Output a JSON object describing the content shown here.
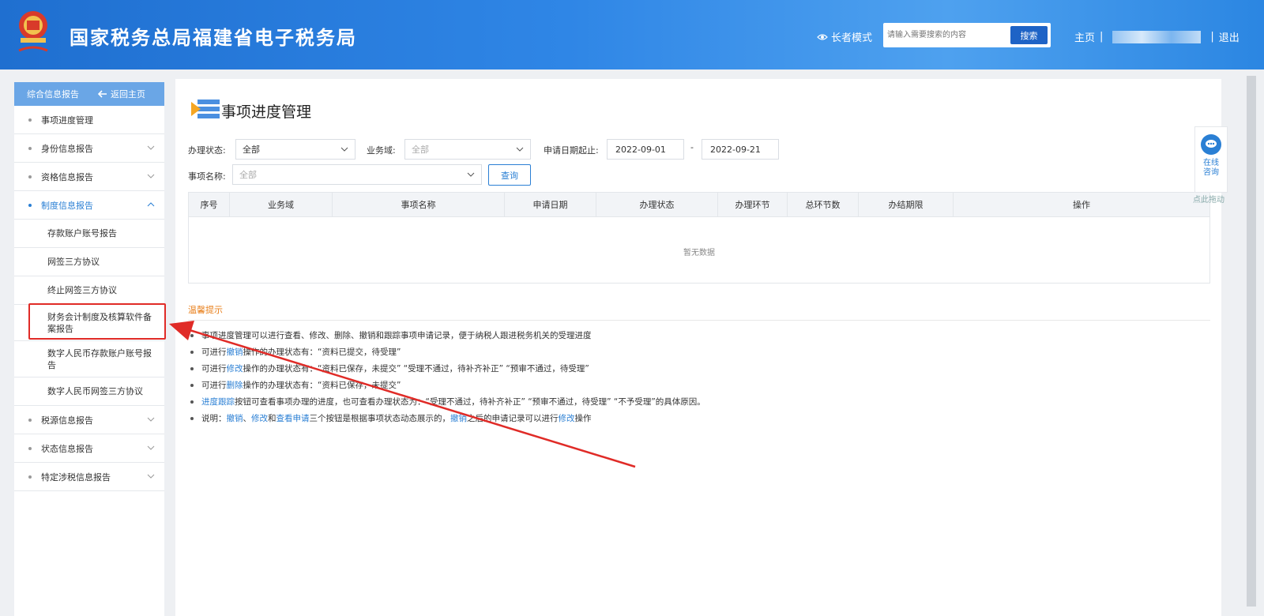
{
  "header": {
    "site_title": "国家税务总局福建省电子税务局",
    "elder_mode": "长者模式",
    "search_placeholder": "请输入需要搜索的内容",
    "search_button": "搜索",
    "home": "主页",
    "separator": "|",
    "logout": "退出"
  },
  "sidebar": {
    "head_title": "综合信息报告",
    "back_home": "返回主页",
    "items": [
      {
        "label": "事项进度管理"
      },
      {
        "label": "身份信息报告"
      },
      {
        "label": "资格信息报告"
      },
      {
        "label": "制度信息报告"
      },
      {
        "label": "税源信息报告"
      },
      {
        "label": "状态信息报告"
      },
      {
        "label": "特定涉税信息报告"
      }
    ],
    "sub_items": [
      {
        "label": "存款账户账号报告"
      },
      {
        "label": "网签三方协议"
      },
      {
        "label": "终止网签三方协议"
      },
      {
        "label": "财务会计制度及核算软件备案报告"
      },
      {
        "label": "数字人民币存款账户账号报告"
      },
      {
        "label": "数字人民币网签三方协议"
      }
    ]
  },
  "main": {
    "title": "事项进度管理",
    "filters": {
      "status_label": "办理状态:",
      "status_value": "全部",
      "domain_label": "业务域:",
      "domain_value": "全部",
      "date_label": "申请日期起止:",
      "date_start": "2022-09-01",
      "date_dash": "-",
      "date_end": "2022-09-21",
      "item_label": "事项名称:",
      "item_value": "全部",
      "query_button": "查询"
    },
    "table": {
      "columns": [
        "序号",
        "业务域",
        "事项名称",
        "申请日期",
        "办理状态",
        "办理环节",
        "总环节数",
        "办结期限",
        "操作"
      ],
      "empty_text": "暂无数据"
    },
    "tips": {
      "title": "温馨提示",
      "lines": [
        {
          "pre": "事项进度管理可以进行查看、修改、删除、撤销和跟踪事项申请记录，便于纳税人跟进税务机关的受理进度"
        },
        {
          "pre": "可进行",
          "link": "撤销",
          "post": "操作的办理状态有：“资料已提交，待受理”"
        },
        {
          "pre": "可进行",
          "link": "修改",
          "post": "操作的办理状态有：“资料已保存，未提交”  “受理不通过，待补齐补正”  “预审不通过，待受理”"
        },
        {
          "pre": "可进行",
          "link": "删除",
          "post": "操作的办理状态有：“资料已保存，未提交”"
        },
        {
          "pre": "",
          "link": "进度跟踪",
          "post": "按钮可查看事项办理的进度，也可查看办理状态为：“受理不通过，待补齐补正”  “预审不通过，待受理”  “不予受理”的具体原因。"
        },
        {
          "pre": "说明：",
          "link": "撤销",
          "mid1": "、",
          "link2": "修改",
          "mid2": "和",
          "link3": "查看申请",
          "mid3": "三个按钮是根据事项状态动态展示的，",
          "link4": "撤销",
          "mid4": "之后的申请记录可以进行",
          "link5": "修改",
          "post": "操作"
        }
      ]
    }
  },
  "float": {
    "consult_line1": "在线",
    "consult_line2": "咨询",
    "drag_tip": "点此拖动"
  },
  "colors": {
    "header_blue": "#2f86e6",
    "link_blue": "#2a7fd4",
    "highlight_red": "#e02b27",
    "tips_orange": "#e87f1b"
  }
}
